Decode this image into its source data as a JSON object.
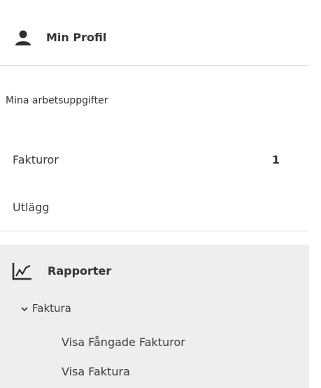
{
  "profile": {
    "label": "Min Profil",
    "icon": "user-icon"
  },
  "tasks": {
    "heading": "Mina arbetsuppgifter",
    "items": [
      {
        "label": "Fakturor",
        "count": "1"
      },
      {
        "label": "Utlägg",
        "count": ""
      }
    ]
  },
  "reports": {
    "label": "Rapporter",
    "icon": "line-chart-icon",
    "group": {
      "label": "Faktura",
      "expanded": true,
      "items": [
        {
          "label": "Visa Fångade Fakturor"
        },
        {
          "label": "Visa Faktura"
        }
      ]
    },
    "background": "#eeeeee"
  }
}
